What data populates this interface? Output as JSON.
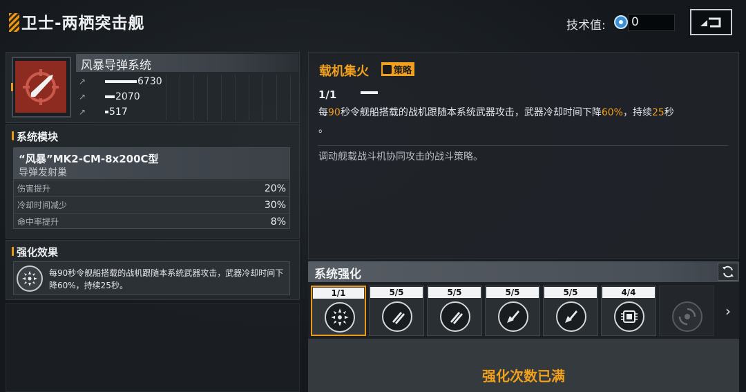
{
  "header": {
    "title": "卫士-两栖突击舰",
    "tech_label": "技术值:",
    "tech_value": "0",
    "back_icon": "back-return-icon"
  },
  "weapon": {
    "name": "风暴导弹系统",
    "icon": "missile-target-icon",
    "stats": [
      {
        "icon": "damage-arrow-icon",
        "value": "6730",
        "fill": 0.45
      },
      {
        "icon": "range-arrow-icon",
        "value": "2070",
        "fill": 0.14
      },
      {
        "icon": "rate-arrow-icon",
        "value": "517",
        "fill": 0.05
      }
    ]
  },
  "module_section": {
    "title": "系统模块",
    "module_name": "“风暴”MK2-CM-8x200C型",
    "module_sub": "导弹发射巢",
    "rows": [
      {
        "key": "伤害提升",
        "value": "20%"
      },
      {
        "key": "冷却时间减少",
        "value": "30%"
      },
      {
        "key": "命中率提升",
        "value": "8%"
      }
    ]
  },
  "enhance_section": {
    "title": "强化效果",
    "icon": "carrier-strike-icon",
    "text": "每90秒令舰船搭载的战机跟随本系统武器攻击，武器冷却时间下降60%，持续25秒。"
  },
  "detail": {
    "title": "载机集火",
    "tag": "策略",
    "level": "1/1",
    "desc_parts": [
      "每",
      "90",
      "秒令舰船搭载的战机跟随本系统武器攻击，武器冷却时间下降",
      "60%",
      "，持续",
      "25",
      "秒",
      "。"
    ],
    "flavor": "调动舰载战斗机协同攻击的战斗策略。"
  },
  "system": {
    "title": "系统强化",
    "refresh_icon": "refresh-icon",
    "slots": [
      {
        "label": "1/1",
        "icon": "carrier-strike-icon",
        "active": true
      },
      {
        "label": "5/5",
        "icon": "missile-pair-icon",
        "active": false
      },
      {
        "label": "5/5",
        "icon": "missile-pair-icon",
        "active": false
      },
      {
        "label": "5/5",
        "icon": "missile-cluster-icon",
        "active": false
      },
      {
        "label": "5/5",
        "icon": "missile-cluster-icon",
        "active": false
      },
      {
        "label": "4/4",
        "icon": "chip-module-icon",
        "active": false
      },
      {
        "label": "",
        "icon": "locked-radar-icon",
        "active": false
      }
    ],
    "full_text": "强化次数已满"
  },
  "colors": {
    "accent": "#f0a01c",
    "weapon_bg": "#8e2b21"
  }
}
